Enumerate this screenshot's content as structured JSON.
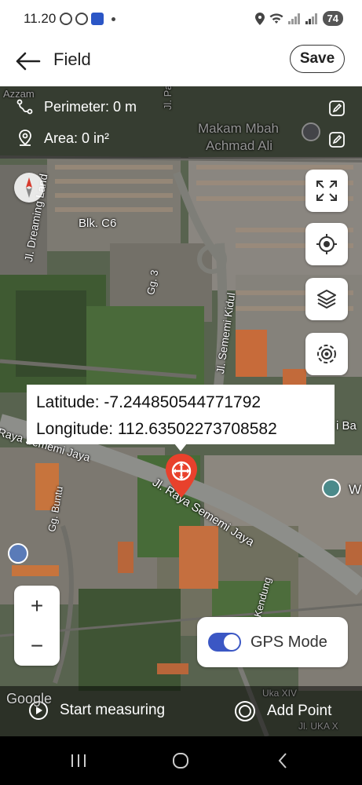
{
  "status_bar": {
    "time": "11.20",
    "battery": "74"
  },
  "app_bar": {
    "title": "Field",
    "save_label": "Save"
  },
  "info": {
    "perimeter": "Perimeter: 0 m",
    "area": "Area: 0 in²"
  },
  "map_labels": {
    "jl_palem": "Jl. Palem",
    "makam_line1": "Makam Mbah",
    "makam_line2": "Achmad Ali",
    "dreaming_land": "Jl. Dreaming Land",
    "blk_c6": "Blk. C6",
    "gg_3": "Gg. 3",
    "semeni_kidul": "Jl. Sememi Kidul",
    "raya_sememi_jaya": "Raya Sememi Jaya",
    "gg_buntu": "Gg. Buntu",
    "sememi_jaya_2": "Jl. Raya Sememi Jaya",
    "kendung": "Jl. Kendung",
    "uka": "Jl. UKA X",
    "uka_xiv": "Uka XIV",
    "azzam": "Azzam",
    "w_label": "W",
    "ba_label": "i Ba"
  },
  "coordinates": {
    "latitude": "Latitude: -7.244850544771792",
    "longitude": "Longitude: 112.63502273708582"
  },
  "zoom": {
    "in_label": "+",
    "out_label": "−"
  },
  "gps": {
    "label": "GPS Mode",
    "enabled": true,
    "accent": "#3b57c4"
  },
  "google_label": "Google",
  "bottom_actions": {
    "start_measuring": "Start measuring",
    "add_point": "Add Point"
  },
  "colors": {
    "pin": "#e8412c",
    "toggle_accent": "#3b57c4"
  },
  "icons": {
    "back": "arrow-left-icon",
    "perimeter": "perimeter-icon",
    "area": "location-pin-icon",
    "edit": "pencil-icon",
    "compass": "compass-icon",
    "fullscreen": "expand-icon",
    "my_location": "crosshair-icon",
    "layers": "layers-icon",
    "gps_target": "target-icon",
    "start": "play-circle-icon",
    "add_point": "radio-circle-icon"
  }
}
